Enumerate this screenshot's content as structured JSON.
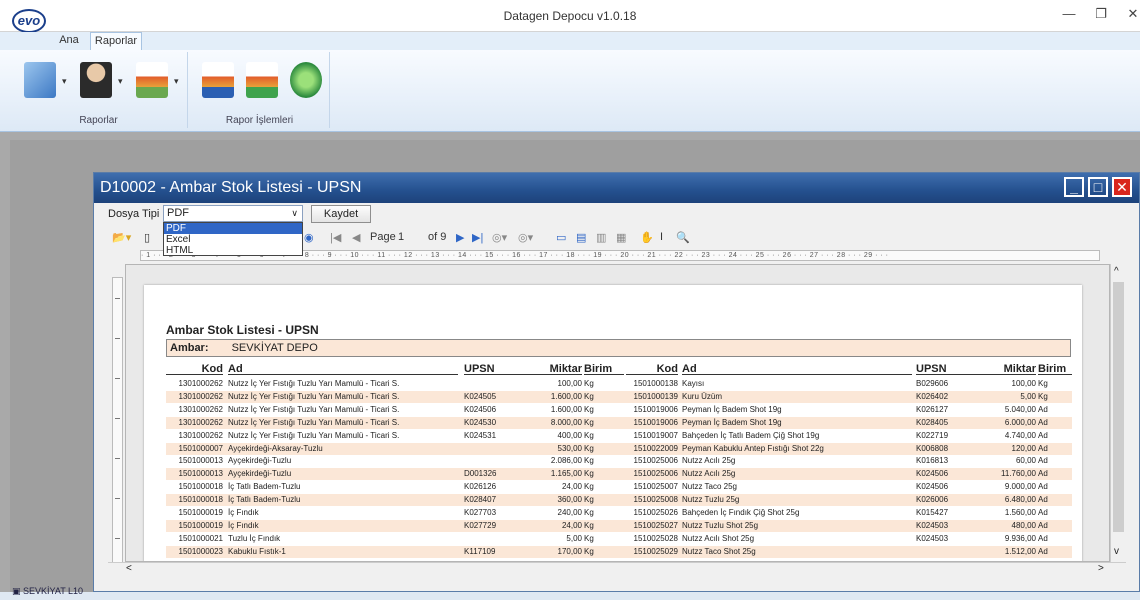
{
  "app": {
    "logo_text": "evo",
    "title": "Datagen Depocu v1.0.18"
  },
  "ribbon": {
    "tabs": [
      "Ana",
      "Raporlar"
    ],
    "groups": [
      "Raporlar",
      "Rapor İşlemleri"
    ]
  },
  "report_window": {
    "title": "D10002 - Ambar Stok Listesi - UPSN",
    "dosya_label": "Dosya Tipi",
    "dosya_value": "PDF",
    "dosya_options": [
      "PDF",
      "Excel",
      "HTML"
    ],
    "save_label": "Kaydet",
    "page_label": "Page",
    "page_current": "1",
    "page_total": "of 9",
    "ruler_text": "· 1 · · · 2 · · · 3 · · · 4 · · · 5 · · · 6 · · · 7 · · · 8 · · · 9 · · · 10 · · · 11 · · · 12 · · · 13 · · · 14 · · · 15 · · · 16 · · · 17 · · · 18 · · · 19 · · · 20 · · · 21 · · · 22 · · · 23 · · · 24 · · · 25 · · · 26 · · · 27 · · · 28 · · · 29 · · ·"
  },
  "report": {
    "title": "Ambar Stok Listesi - UPSN",
    "ambar_label": "Ambar:",
    "ambar_value": "SEVKİYAT DEPO",
    "headers": {
      "kod": "Kod",
      "ad": "Ad",
      "upsn": "UPSN",
      "miktar": "Miktar",
      "birim": "Birim"
    },
    "left_rows": [
      [
        "1301000262",
        "Nutzz İç Yer Fıstığı Tuzlu Yarı Mamulü - Ticari S.",
        "",
        "100,00",
        "Kg"
      ],
      [
        "1301000262",
        "Nutzz İç Yer Fıstığı Tuzlu Yarı Mamulü - Ticari S.",
        "K024505",
        "1.600,00",
        "Kg"
      ],
      [
        "1301000262",
        "Nutzz İç Yer Fıstığı Tuzlu Yarı Mamulü - Ticari S.",
        "K024506",
        "1.600,00",
        "Kg"
      ],
      [
        "1301000262",
        "Nutzz İç Yer Fıstığı Tuzlu Yarı Mamulü - Ticari S.",
        "K024530",
        "8.000,00",
        "Kg"
      ],
      [
        "1301000262",
        "Nutzz İç Yer Fıstığı Tuzlu Yarı Mamulü - Ticari S.",
        "K024531",
        "400,00",
        "Kg"
      ],
      [
        "1501000007",
        "Ayçekirdeği-Aksaray-Tuzlu",
        "",
        "530,00",
        "Kg"
      ],
      [
        "1501000013",
        "Ayçekirdeği-Tuzlu",
        "",
        "2.086,00",
        "Kg"
      ],
      [
        "1501000013",
        "Ayçekirdeği-Tuzlu",
        "D001326",
        "1.165,00",
        "Kg"
      ],
      [
        "1501000018",
        "İç Tatlı Badem-Tuzlu",
        "K026126",
        "24,00",
        "Kg"
      ],
      [
        "1501000018",
        "İç Tatlı Badem-Tuzlu",
        "K028407",
        "360,00",
        "Kg"
      ],
      [
        "1501000019",
        "İç Fındık",
        "K027703",
        "240,00",
        "Kg"
      ],
      [
        "1501000019",
        "İç Fındık",
        "K027729",
        "24,00",
        "Kg"
      ],
      [
        "1501000021",
        "Tuzlu İç Fındık",
        "",
        "5,00",
        "Kg"
      ],
      [
        "1501000023",
        "Kabuklu Fıstık-1",
        "K117109",
        "170,00",
        "Kg"
      ]
    ],
    "right_rows": [
      [
        "1501000138",
        "Kayısı",
        "B029606",
        "100,00",
        "Kg"
      ],
      [
        "1501000139",
        "Kuru Üzüm",
        "K026402",
        "5,00",
        "Kg"
      ],
      [
        "1510019006",
        "Peyman İç Badem Shot 19g",
        "K026127",
        "5.040,00",
        "Ad"
      ],
      [
        "1510019006",
        "Peyman İç Badem Shot 19g",
        "K028405",
        "6.000,00",
        "Ad"
      ],
      [
        "1510019007",
        "Bahçeden İç Tatlı Badem Çiğ Shot 19g",
        "K022719",
        "4.740,00",
        "Ad"
      ],
      [
        "1510022009",
        "Peyman Kabuklu Antep Fıstığı Shot 22g",
        "K006808",
        "120,00",
        "Ad"
      ],
      [
        "1510025006",
        "Nutzz Acılı 25g",
        "K016813",
        "60,00",
        "Ad"
      ],
      [
        "1510025006",
        "Nutzz Acılı 25g",
        "K024506",
        "11.760,00",
        "Ad"
      ],
      [
        "1510025007",
        "Nutzz Taco 25g",
        "K024506",
        "9.000,00",
        "Ad"
      ],
      [
        "1510025008",
        "Nutzz Tuzlu 25g",
        "K026006",
        "6.480,00",
        "Ad"
      ],
      [
        "1510025026",
        "Bahçeden İç Fındık Çiğ Shot 25g",
        "K015427",
        "1.560,00",
        "Ad"
      ],
      [
        "1510025027",
        "Nutzz Tuzlu Shot 25g",
        "K024503",
        "480,00",
        "Ad"
      ],
      [
        "1510025028",
        "Nutzz Acılı Shot 25g",
        "K024503",
        "9.936,00",
        "Ad"
      ],
      [
        "1510025029",
        "Nutzz Taco Shot 25g",
        "",
        "1.512,00",
        "Ad"
      ]
    ]
  },
  "taskbar": {
    "item_label": "SEVKİYAT L10"
  },
  "colors": {
    "row_alt": "#fbe7d7",
    "title_bar": "#24508e",
    "close_red": "#d9261c"
  }
}
